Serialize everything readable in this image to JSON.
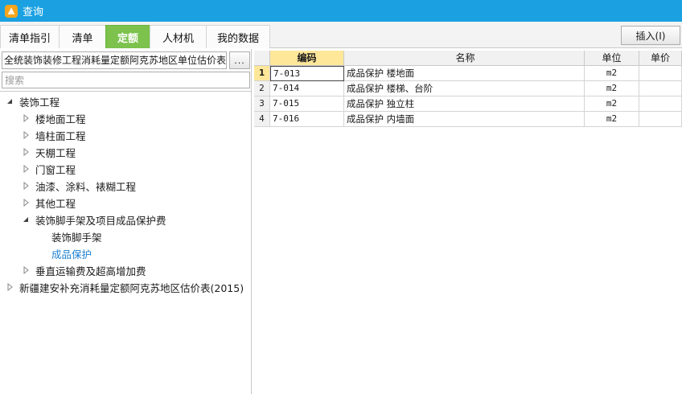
{
  "window": {
    "title": "查询",
    "app_icon": "app-logo-icon",
    "accent": "#1ba1e2"
  },
  "tabs": [
    {
      "label": "清单指引",
      "active": false
    },
    {
      "label": "清单",
      "active": false
    },
    {
      "label": "定额",
      "active": true
    },
    {
      "label": "人材机",
      "active": false
    },
    {
      "label": "我的数据",
      "active": false
    }
  ],
  "toolbar": {
    "insert_label": "插入(I)"
  },
  "left": {
    "database_value": "全统装饰装修工程消耗量定额阿克苏地区单位估价表",
    "more_label": "...",
    "search_placeholder": "搜索",
    "tree": [
      {
        "label": "装饰工程",
        "expanded": true
      },
      {
        "label": "楼地面工程",
        "expanded": false
      },
      {
        "label": "墙柱面工程",
        "expanded": false
      },
      {
        "label": "天棚工程",
        "expanded": false
      },
      {
        "label": "门窗工程",
        "expanded": false
      },
      {
        "label": "油漆、涂料、裱糊工程",
        "expanded": false
      },
      {
        "label": "其他工程",
        "expanded": false
      },
      {
        "label": "装饰脚手架及项目成品保护费",
        "expanded": true
      },
      {
        "label": "装饰脚手架"
      },
      {
        "label": "成品保护",
        "selected": true
      },
      {
        "label": "垂直运输费及超高增加费",
        "expanded": false
      },
      {
        "label": "新疆建安补充消耗量定额阿克苏地区估价表(2015)",
        "expanded": false
      }
    ]
  },
  "grid": {
    "columns": {
      "code": "编码",
      "name": "名称",
      "unit": "单位",
      "price": "单价"
    },
    "rows": [
      {
        "num": "1",
        "code": "7-013",
        "name": "成品保护 楼地面",
        "unit": "m2"
      },
      {
        "num": "2",
        "code": "7-014",
        "name": "成品保护 楼梯、台阶",
        "unit": "m2"
      },
      {
        "num": "3",
        "code": "7-015",
        "name": "成品保护 独立柱",
        "unit": "m2"
      },
      {
        "num": "4",
        "code": "7-016",
        "name": "成品保护 内墙面",
        "unit": "m2"
      }
    ]
  },
  "colors": {
    "active_tab": "#7cc24d",
    "header_highlight": "#ffe79a",
    "selected_text": "#1a7fd0"
  }
}
